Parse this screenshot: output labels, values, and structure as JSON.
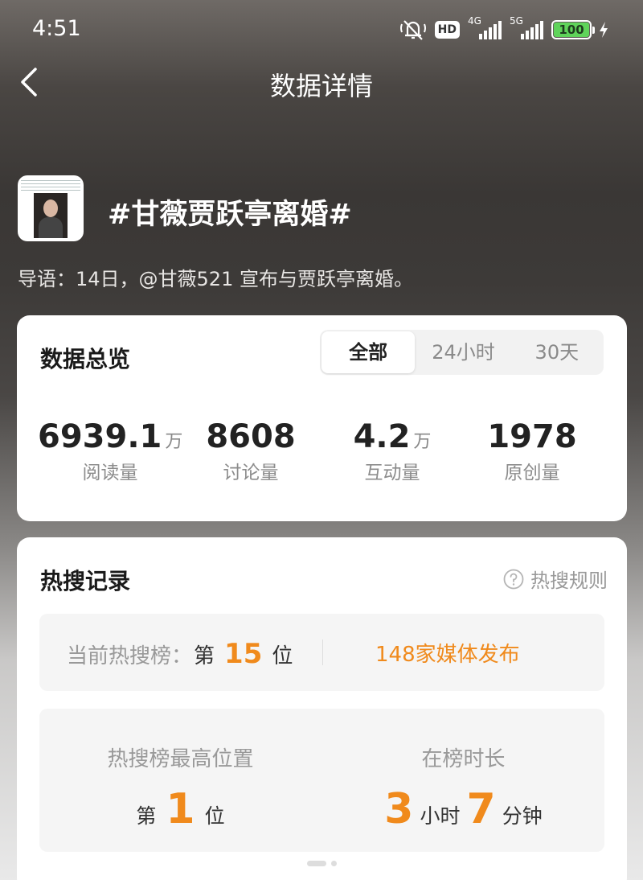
{
  "status_bar": {
    "time": "4:51",
    "hd_label": "HD",
    "network_1": "4G",
    "network_2": "5G",
    "battery": "100"
  },
  "nav": {
    "title": "数据详情"
  },
  "topic": {
    "title": "#甘薇贾跃亭离婚#",
    "intro": "导语：14日，@甘薇521 宣布与贾跃亭离婚。"
  },
  "overview": {
    "title": "数据总览",
    "tabs": [
      "全部",
      "24小时",
      "30天"
    ],
    "selected_tab": "全部",
    "stats": [
      {
        "value": "6939.1",
        "unit": "万",
        "label": "阅读量"
      },
      {
        "value": "8608",
        "unit": "",
        "label": "讨论量"
      },
      {
        "value": "4.2",
        "unit": "万",
        "label": "互动量"
      },
      {
        "value": "1978",
        "unit": "",
        "label": "原创量"
      }
    ]
  },
  "hot_record": {
    "title": "热搜记录",
    "rule_label": "热搜规则",
    "current": {
      "prefix": "当前热搜榜：",
      "di": "第",
      "rank": "15",
      "wei": "位",
      "media": "148家媒体发布"
    },
    "highest": {
      "label": "热搜榜最高位置",
      "di": "第",
      "rank": "1",
      "wei": "位"
    },
    "duration": {
      "label": "在榜时长",
      "hours": "3",
      "hours_unit": "小时",
      "minutes": "7",
      "minutes_unit": "分钟"
    }
  },
  "colors": {
    "accent": "#f08a1c",
    "battery": "#5fd35a"
  }
}
